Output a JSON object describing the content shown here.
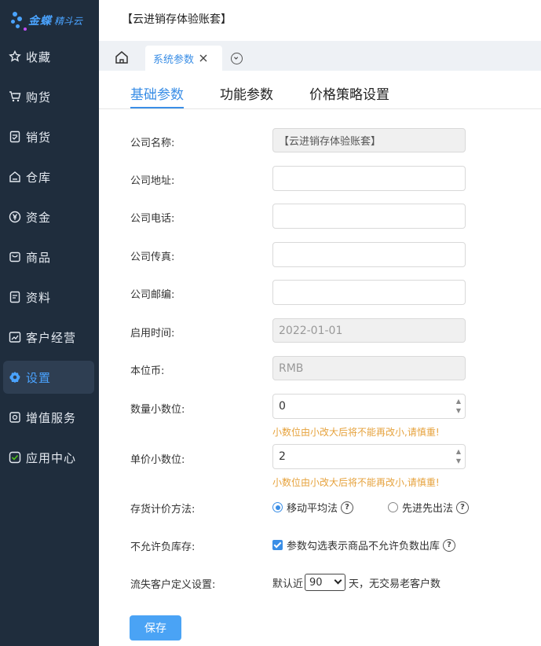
{
  "app": {
    "logo_text": "金蝶",
    "logo_sub": "精斗云",
    "company_title": "【云进销存体验账套】"
  },
  "sidebar": {
    "items": [
      {
        "label": "收藏",
        "icon": "star-icon"
      },
      {
        "label": "购货",
        "icon": "cart-icon"
      },
      {
        "label": "销货",
        "icon": "invoice-icon"
      },
      {
        "label": "仓库",
        "icon": "warehouse-icon"
      },
      {
        "label": "资金",
        "icon": "yen-icon"
      },
      {
        "label": "商品",
        "icon": "bag-icon"
      },
      {
        "label": "资料",
        "icon": "document-icon"
      },
      {
        "label": "客户经营",
        "icon": "chart-icon"
      },
      {
        "label": "设置",
        "icon": "gear-icon",
        "active": true
      },
      {
        "label": "增值服务",
        "icon": "service-icon"
      },
      {
        "label": "应用中心",
        "icon": "apps-icon"
      }
    ]
  },
  "tabs": {
    "open_tab": "系统参数"
  },
  "subtabs": [
    "基础参数",
    "功能参数",
    "价格策略设置"
  ],
  "form": {
    "company_name": {
      "label": "公司名称:",
      "value": "【云进销存体验账套】"
    },
    "company_address": {
      "label": "公司地址:",
      "value": ""
    },
    "company_phone": {
      "label": "公司电话:",
      "value": ""
    },
    "company_fax": {
      "label": "公司传真:",
      "value": ""
    },
    "company_zip": {
      "label": "公司邮编:",
      "value": ""
    },
    "start_date": {
      "label": "启用时间:",
      "value": "2022-01-01"
    },
    "currency": {
      "label": "本位币:",
      "value": "RMB"
    },
    "qty_decimals": {
      "label": "数量小数位:",
      "value": "0",
      "warning": "小数位由小改大后将不能再改小,请慎重!"
    },
    "price_decimals": {
      "label": "单价小数位:",
      "value": "2",
      "warning": "小数位由小改大后将不能再改小,请慎重!"
    },
    "costing": {
      "label": "存货计价方法:",
      "option1": "移动平均法",
      "option2": "先进先出法",
      "selected": "移动平均法"
    },
    "negative_stock": {
      "label": "不允许负库存:",
      "checkbox_label": "参数勾选表示商品不允许负数出库",
      "checked": true
    },
    "lost_customer": {
      "label": "流失客户定义设置:",
      "prefix": "默认近",
      "days": "90",
      "suffix": "天，无交易老客户数"
    },
    "help_glyph": "?"
  },
  "buttons": {
    "save": "保存"
  },
  "colors": {
    "sidebar_bg": "#1f2d3d",
    "accent": "#3a8ee6",
    "warning": "#e6a23c",
    "save_btn": "#4aa3f5"
  }
}
